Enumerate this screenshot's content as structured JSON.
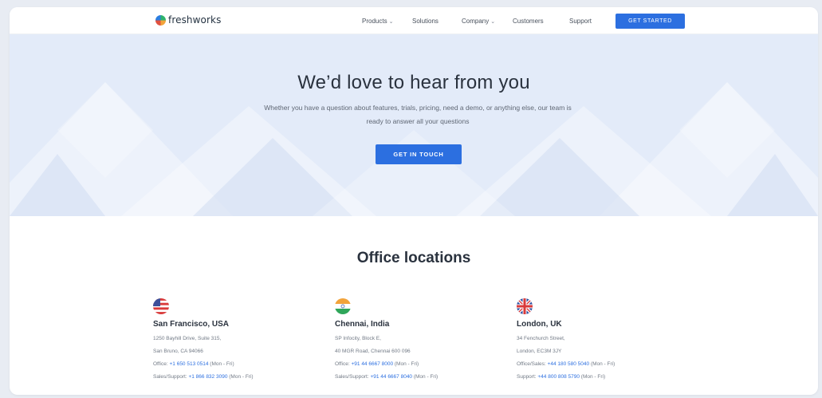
{
  "header": {
    "logo_text": "freshworks",
    "nav": [
      {
        "label": "Products",
        "dropdown": true
      },
      {
        "label": "Solutions",
        "dropdown": false
      },
      {
        "label": "Company",
        "dropdown": true
      },
      {
        "label": "Customers",
        "dropdown": false
      },
      {
        "label": "Support",
        "dropdown": false
      }
    ],
    "cta_label": "GET STARTED"
  },
  "hero": {
    "title": "We’d love to hear from you",
    "subtitle_line1": "Whether you have a question about features, trials, pricing, need a demo, or anything else, our team is",
    "subtitle_line2": "ready to answer all your questions",
    "cta_label": "GET IN TOUCH"
  },
  "offices": {
    "title": "Office locations",
    "items": [
      {
        "flag": "usa-flag-icon",
        "name": "San Francisco, USA",
        "address1": "1250 Bayhill Drive, Suite 315,",
        "address2": "San Bruno, CA 94066",
        "line1_label": "Office: ",
        "line1_phone": "+1 650 513 0514",
        "line1_suffix": " (Mon - Fri)",
        "line2_label": "Sales/Support: ",
        "line2_phone": "+1 866 832 3090",
        "line2_suffix": " (Mon - Fri)"
      },
      {
        "flag": "india-flag-icon",
        "name": "Chennai, India",
        "address1": "SP Infocity, Block E,",
        "address2": "40 MGR Road, Chennai 600 096",
        "line1_label": "Office: ",
        "line1_phone": "+91 44 6667 8000",
        "line1_suffix": " (Mon - Fri)",
        "line2_label": "Sales/Support: ",
        "line2_phone": "+91 44 6667 8040",
        "line2_suffix": " (Mon - Fri)"
      },
      {
        "flag": "uk-flag-icon",
        "name": "London, UK",
        "address1": "34 Fenchurch Street,",
        "address2": "London, EC3M 3JY",
        "line1_label": "Office/Sales: ",
        "line1_phone": "+44 180 580 5040",
        "line1_suffix": " (Mon - Fri)",
        "line2_label": "Support: ",
        "line2_phone": "+44 800 808 5790",
        "line2_suffix": " (Mon - Fri)"
      }
    ]
  },
  "colors": {
    "accent": "#2c6fe0",
    "hero_bg": "#e3ebf9",
    "page_bg": "#e8ecf3"
  }
}
